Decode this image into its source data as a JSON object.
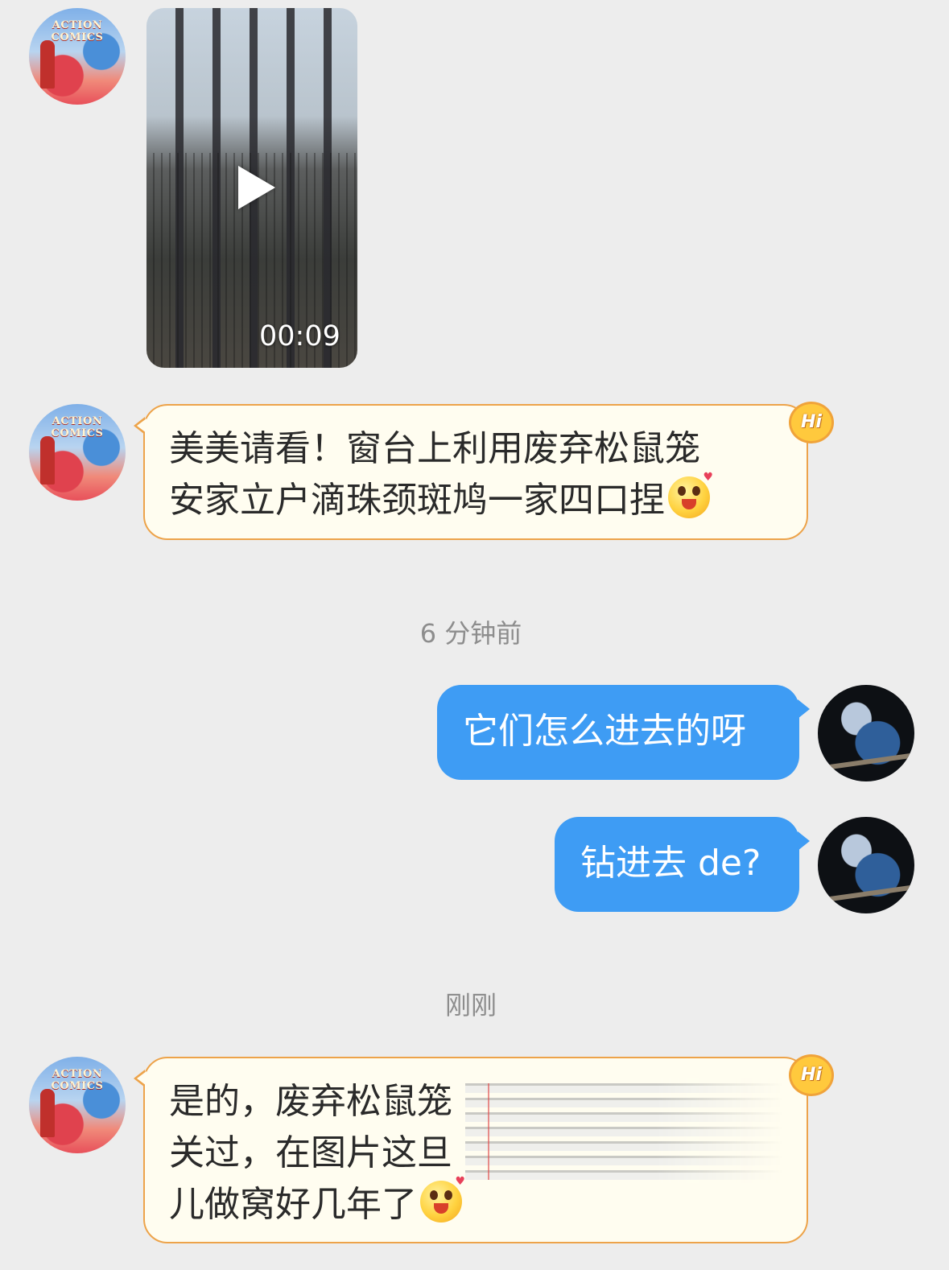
{
  "messages": {
    "video": {
      "duration": "00:09"
    },
    "msg1": {
      "line1": "美美请看！窗台上利用废弃松鼠笼",
      "line2": "安家立户滴珠颈斑鸠一家四口捏",
      "badge": "Hi"
    },
    "time1": "6 分钟前",
    "msg2": {
      "text": "它们怎么进去的呀"
    },
    "msg3": {
      "text": "钻进去 de?"
    },
    "time2": "刚刚",
    "msg4": {
      "line1": "是的，废弃松鼠笼",
      "line2": "关过，在图片这旦",
      "line3": "儿做窝好几年了",
      "badge": "Hi"
    }
  },
  "avatars": {
    "left_text": "ACTION COMICS"
  },
  "colors": {
    "background": "#ededed",
    "left_bubble_bg": "#fffdf0",
    "left_bubble_border": "#eda34a",
    "right_bubble_bg": "#3e9cf4",
    "timestamp": "#8d8d8d"
  },
  "icons": {
    "play": "play-icon",
    "emoji": "blush-grin-emoji-icon",
    "badge": "hi-badge-icon"
  }
}
